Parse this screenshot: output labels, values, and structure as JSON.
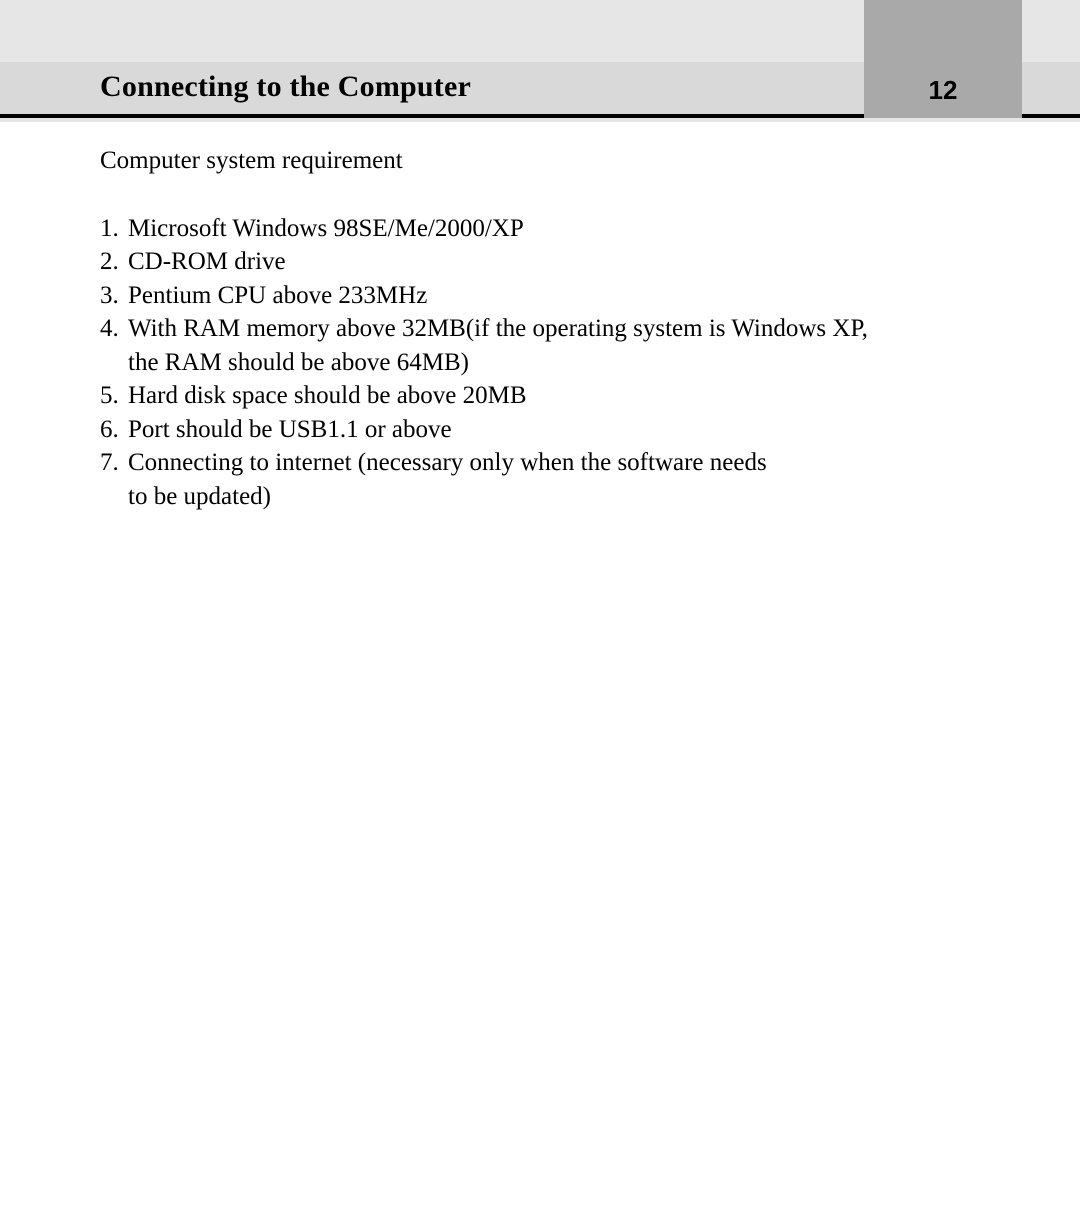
{
  "header": {
    "title": "Connecting to the Computer",
    "page_number": "12"
  },
  "content": {
    "intro": "Computer system requirement",
    "requirements": [
      {
        "n": "1.",
        "line1": "Microsoft Windows 98SE/Me/2000/XP",
        "line2": ""
      },
      {
        "n": "2.",
        "line1": "CD-ROM drive",
        "line2": ""
      },
      {
        "n": "3.",
        "line1": "Pentium CPU above 233MHz",
        "line2": ""
      },
      {
        "n": "4.",
        "line1": "With RAM memory above 32MB(if the operating system is Windows XP,",
        "line2": "the RAM should be above 64MB)"
      },
      {
        "n": "5.",
        "line1": "Hard disk space should be above 20MB",
        "line2": ""
      },
      {
        "n": "6.",
        "line1": "Port should be USB1.1 or above",
        "line2": ""
      },
      {
        "n": "7.",
        "line1": "Connecting to internet (necessary only when the software needs",
        "line2": "to be updated)"
      }
    ]
  }
}
